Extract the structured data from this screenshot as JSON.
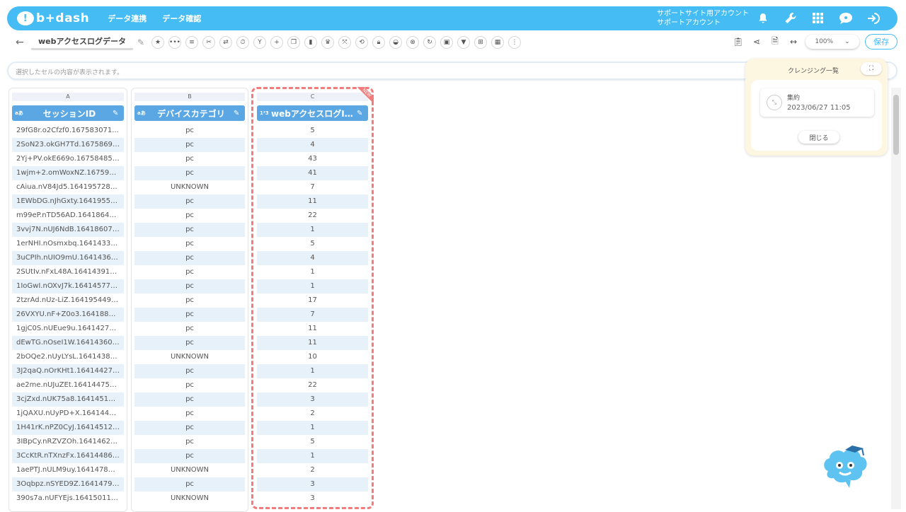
{
  "header": {
    "logo_text": "b+dash",
    "nav": [
      "データ連携",
      "データ確認"
    ],
    "account_line1": "サポートサイト用アカウント",
    "account_line2": "サポートアカウント",
    "icons": [
      "bell-icon",
      "wrench-icon",
      "grid-icon",
      "chat-icon",
      "logout-icon"
    ],
    "accent": "#45bcf3"
  },
  "toolbar": {
    "back": "←",
    "sheet_title": "webアクセスログデータ",
    "buttons": [
      "star",
      "more",
      "list",
      "tools",
      "swap",
      "timer",
      "merge",
      "add",
      "copy",
      "trash",
      "crown",
      "expand",
      "repeat",
      "lock",
      "bucket",
      "cancel",
      "refresh",
      "box",
      "filter",
      "split",
      "table",
      "ruler"
    ],
    "zoom": "100%",
    "save_label": "保存"
  },
  "cell_bar": {
    "placeholder": "選択したセルの内容が表示されます。"
  },
  "columns": [
    {
      "letter": "A",
      "type": "aあ",
      "label": "セッションID",
      "values": [
        "29fG8r.o2Cfzf0.167583071...",
        "2SoN23.okGH7Td.16758699...",
        "2Yj+PV.okE669o.167584859...",
        "1wjm+2.omWoxNZ.16759058...",
        "cAiua.nV84Jd5.1641957282...",
        "1EWbDG.nJhGxty.16419550...",
        "m99eP.nTD56AD.164186411...",
        "3vvj7N.nUJ6NdB.164186075...",
        "1erNHI.nOsmxbq.164143378...",
        "3uCPIh.nUIO9mU.164143648...",
        "2SUtIv.nFxL48A.164143915...",
        "1IoGwI.nOXvJ7k.164145778...",
        "2tzrAd.nUz-LiZ.1641954494...",
        "26VXYU.nF+Z0o3.16418881...",
        "1gjC0S.nUEue9u.164142736...",
        "dEwTG.nOseI1W.164143603...",
        "2bOQe2.nUyLYsL.164143844...",
        "3J2qaQ.nOrKHt1.164144270...",
        "ae2me.nUJuZEt.1641447548...",
        "3cjZxd.nUK75a8.164145111...",
        "1jQAXU.nUyPD+X.16414452...",
        "1H41rK.nPZ0CyJ.164145128...",
        "3IBpCy.nRZVZOh.164146216...",
        "3CcKtR.nTXnzFx.164144866...",
        "1aePTJ.nULM9uy.164147865...",
        "3Oqbpz.nSYED9Z.16414797...",
        "390s7a.nUFYEjs.164150119..."
      ]
    },
    {
      "letter": "B",
      "type": "aあ",
      "label": "デバイスカテゴリ",
      "values": [
        "pc",
        "pc",
        "pc",
        "pc",
        "UNKNOWN",
        "pc",
        "pc",
        "pc",
        "pc",
        "pc",
        "pc",
        "pc",
        "pc",
        "pc",
        "pc",
        "pc",
        "UNKNOWN",
        "pc",
        "pc",
        "pc",
        "pc",
        "pc",
        "pc",
        "pc",
        "UNKNOWN",
        "pc",
        "UNKNOWN"
      ]
    },
    {
      "letter": "C",
      "type": "1²3",
      "label": "webアクセスログID(…",
      "values": [
        "5",
        "4",
        "43",
        "41",
        "7",
        "11",
        "22",
        "1",
        "5",
        "4",
        "1",
        "1",
        "17",
        "7",
        "11",
        "11",
        "10",
        "1",
        "22",
        "3",
        "2",
        "1",
        "5",
        "1",
        "2",
        "3",
        "3"
      ]
    }
  ],
  "new_badge": "NEW",
  "panel": {
    "title": "クレンジング一覧",
    "item_title": "集約",
    "item_time": "2023/06/27 11:05",
    "close_label": "閉じる"
  }
}
